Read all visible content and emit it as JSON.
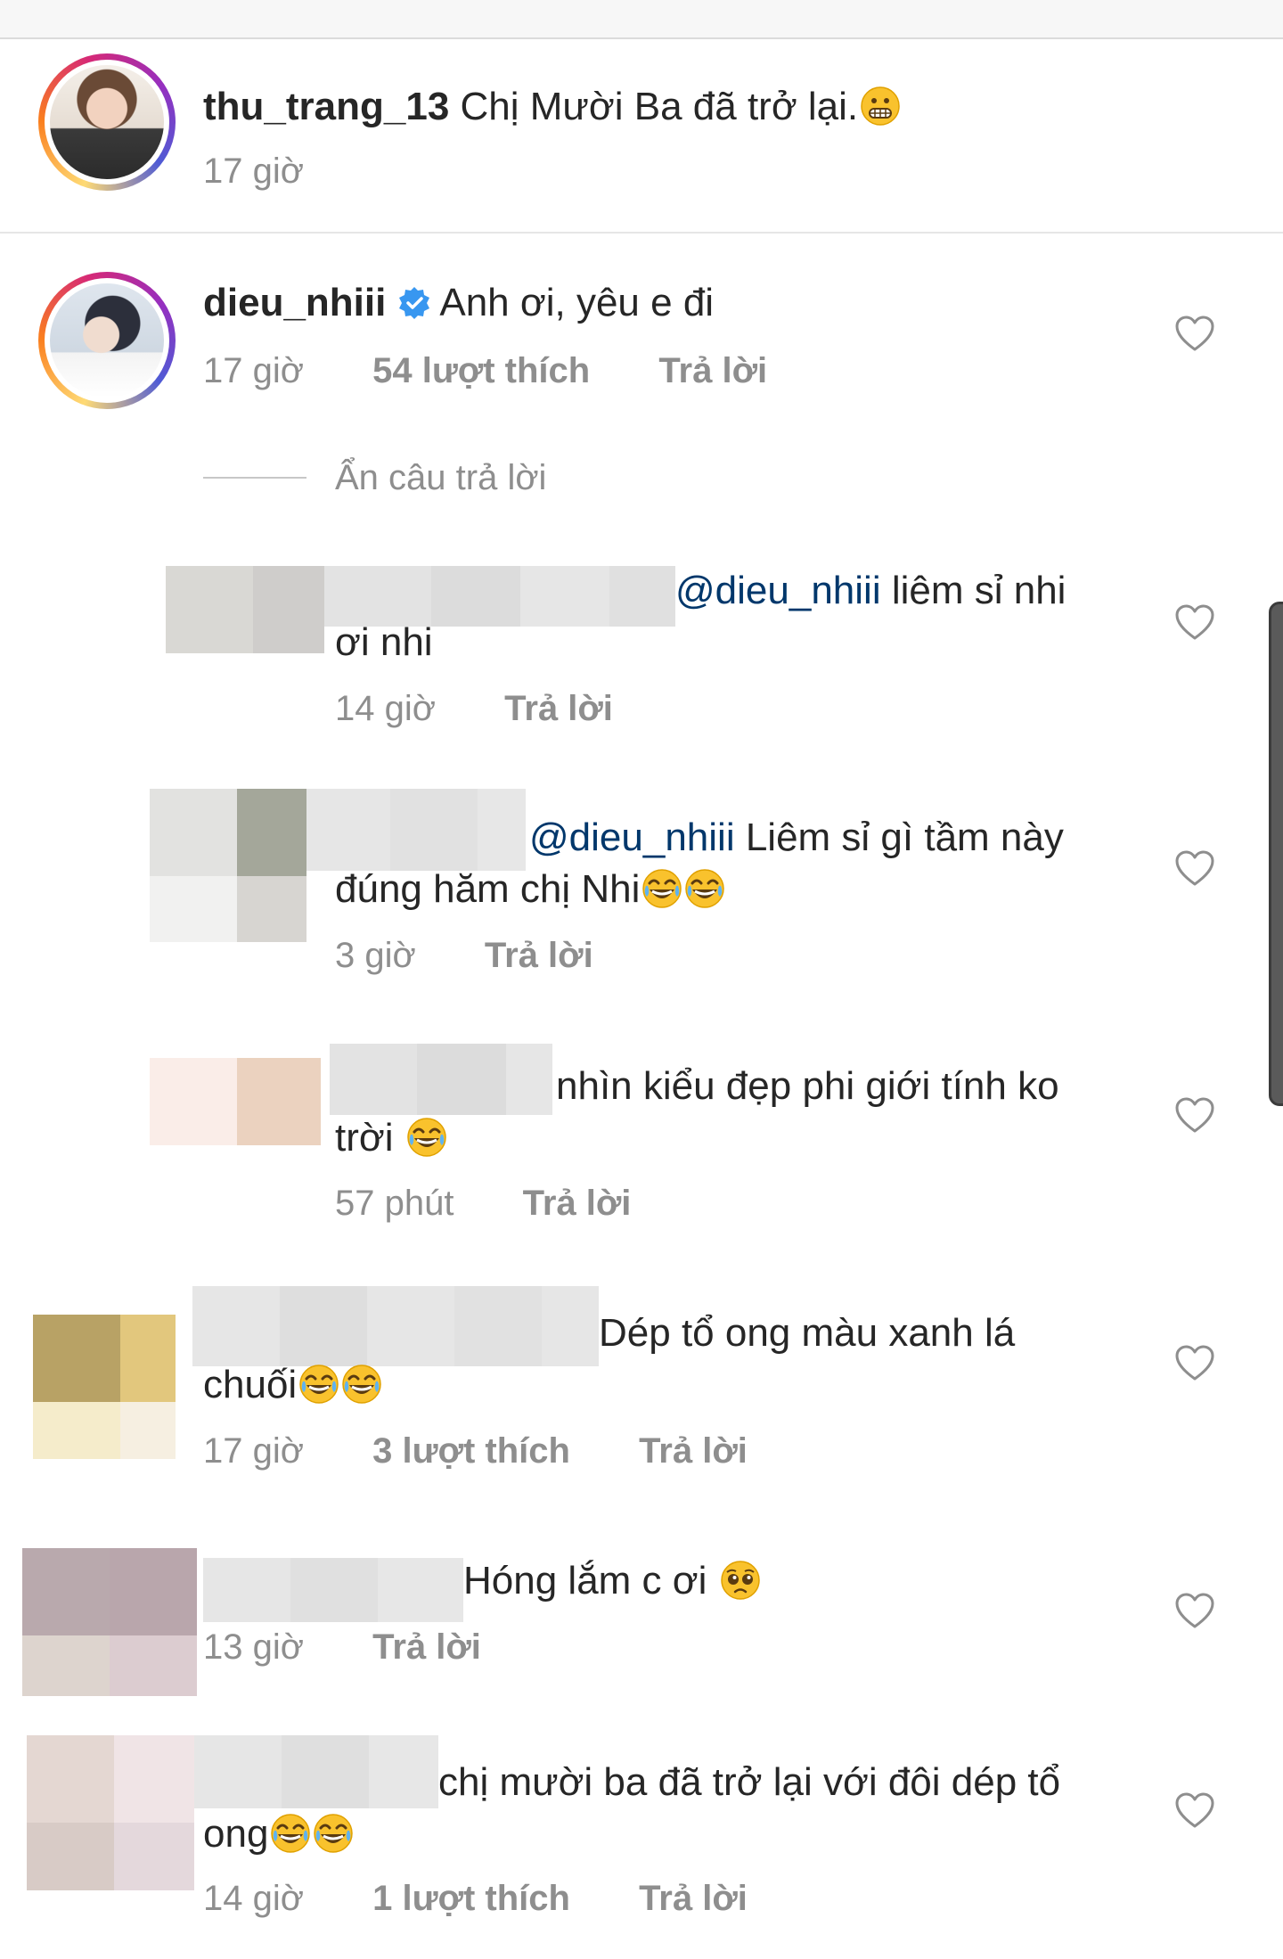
{
  "caption": {
    "username": "thu_trang_13",
    "text": "Chị Mười Ba đã trở lại.",
    "emoji": "grimacing-face",
    "time": "17 giờ"
  },
  "comments": [
    {
      "username": "dieu_nhiii",
      "verified": true,
      "text": "Anh ơi, yêu e đi",
      "time": "17 giờ",
      "likes": "54 lượt thích",
      "reply": "Trả lời"
    }
  ],
  "hide_replies": "Ẩn câu trả lời",
  "replies": [
    {
      "mention": "@dieu_nhiii",
      "line1": "liêm sỉ nhi",
      "line2": "ơi nhi",
      "time": "14 giờ",
      "reply": "Trả lời"
    },
    {
      "mention": "@dieu_nhiii",
      "line1": "Liêm sỉ gì tầm này",
      "line2": "đúng hăm chị Nhi",
      "emojis": [
        "tears-of-joy",
        "tears-of-joy"
      ],
      "time": "3 giờ",
      "reply": "Trả lời"
    },
    {
      "line1": "nhìn kiểu đẹp phi giới tính ko",
      "line2": "trời",
      "emojis": [
        "tears-of-joy"
      ],
      "time": "57 phút",
      "reply": "Trả lời"
    }
  ],
  "more_comments": [
    {
      "line1": "Dép tổ ong màu xanh lá",
      "line2": "chuối",
      "emojis": [
        "tears-of-joy",
        "tears-of-joy"
      ],
      "time": "17 giờ",
      "likes": "3 lượt thích",
      "reply": "Trả lời"
    },
    {
      "line1": "Hóng lắm c ơi",
      "emojis": [
        "pleading-face"
      ],
      "time": "13 giờ",
      "reply": "Trả lời"
    },
    {
      "line1": "chị mười ba đã trở lại với đôi dép tổ",
      "line2": "ong",
      "emojis": [
        "tears-of-joy",
        "tears-of-joy"
      ],
      "time": "14 giờ",
      "likes": "1 lượt thích",
      "reply": "Trả lời"
    }
  ],
  "colors": {
    "text": "#262626",
    "secondary": "#8e8e8e",
    "mention": "#00376b",
    "verified": "#3897f0"
  }
}
